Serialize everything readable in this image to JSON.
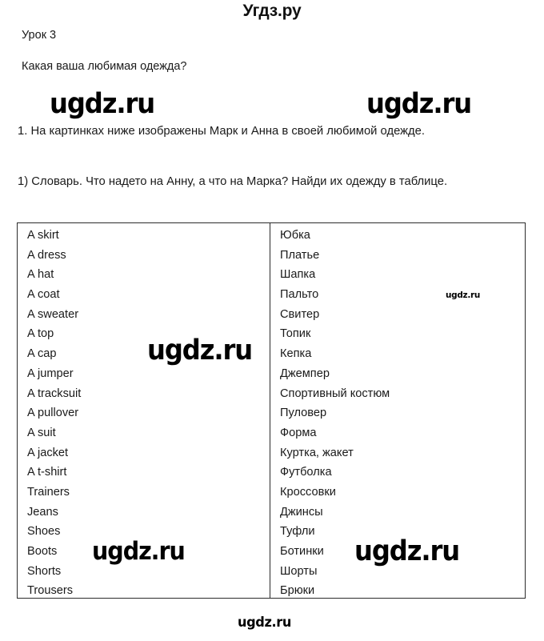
{
  "site": {
    "header_title": "Угдз.ру",
    "footer_watermark": "ugdz.ru"
  },
  "lesson": {
    "label": "Урок 3",
    "question": "Какая ваша любимая одежда?",
    "task_1": "1. На картинках ниже изображены Марк и Анна в своей любимой одежде.",
    "task_1a": "1) Словарь. Что надето на Анну, а что на Марка? Найди их одежду в таблице."
  },
  "vocab_table": {
    "rows": [
      {
        "en": "A skirt",
        "ru": "Юбка"
      },
      {
        "en": "A dress",
        "ru": "Платье"
      },
      {
        "en": "A hat",
        "ru": "Шапка"
      },
      {
        "en": "A coat",
        "ru": "Пальто"
      },
      {
        "en": "A sweater",
        "ru": "Свитер"
      },
      {
        "en": "A top",
        "ru": "Топик"
      },
      {
        "en": "A cap",
        "ru": "Кепка"
      },
      {
        "en": "A jumper",
        "ru": "Джемпер"
      },
      {
        "en": "A tracksuit",
        "ru": "Спортивный костюм"
      },
      {
        "en": "A pullover",
        "ru": "Пуловер"
      },
      {
        "en": "A suit",
        "ru": "Форма"
      },
      {
        "en": "A jacket",
        "ru": "Куртка, жакет"
      },
      {
        "en": "A t-shirt",
        "ru": "Футболка"
      },
      {
        "en": "Trainers",
        "ru": "Кроссовки"
      },
      {
        "en": "Jeans",
        "ru": "Джинсы"
      },
      {
        "en": "Shoes",
        "ru": "Туфли"
      },
      {
        "en": "Boots",
        "ru": "Ботинки"
      },
      {
        "en": "Shorts",
        "ru": "Шорты"
      },
      {
        "en": "Trousers",
        "ru": "Брюки"
      }
    ]
  },
  "watermarks": {
    "top_left": "ugdz.ru",
    "top_right": "ugdz.ru",
    "middle": "ugdz.ru",
    "column_small": "ugdz.ru",
    "lower_left": "ugdz.ru",
    "lower_right": "ugdz.ru",
    "bottom": "ugdz.ru"
  },
  "colors": {
    "text": "#1a1a1a",
    "border": "#2b2b2b",
    "background": "#ffffff",
    "watermark": "#000000"
  }
}
